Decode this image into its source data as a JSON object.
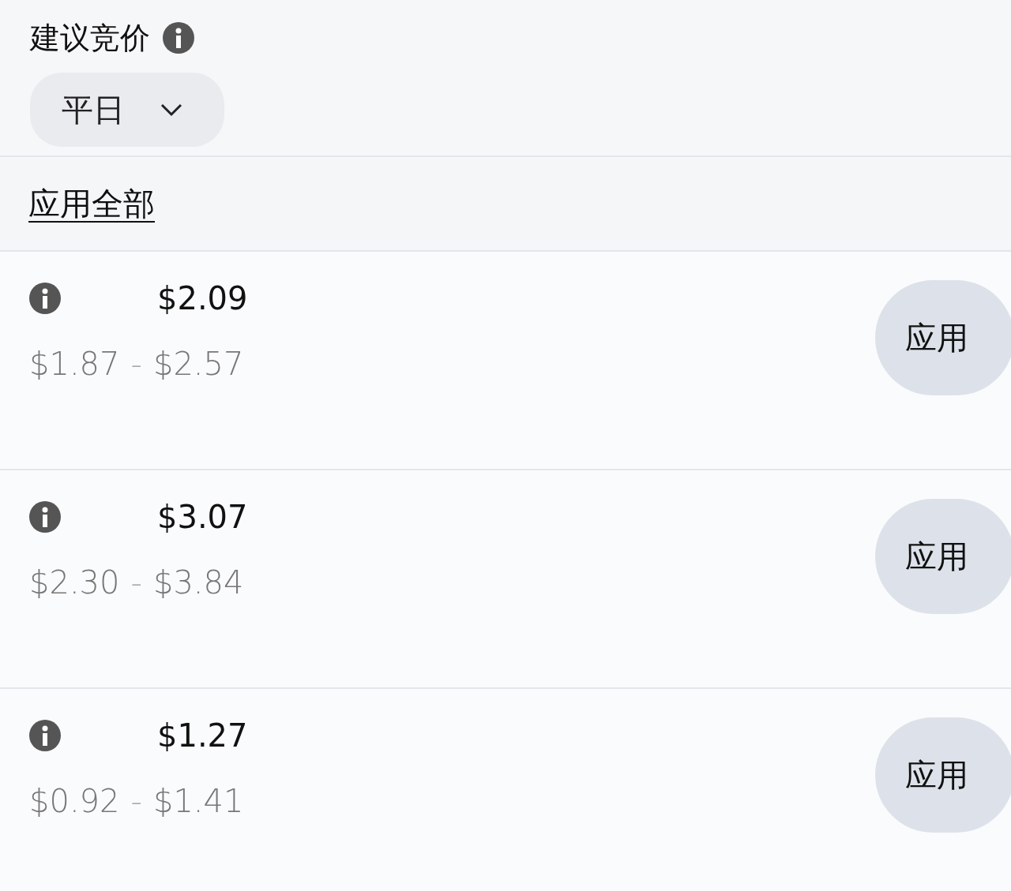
{
  "title": "建议竞价",
  "day_filter": {
    "value": "平日"
  },
  "apply_all": "应用全部",
  "bids": [
    {
      "price": "$2.09",
      "range_low": "$1.87",
      "separator": "-",
      "range_high": "$2.57",
      "button": "应用"
    },
    {
      "price": "$3.07",
      "range_low": "$2.30",
      "separator": "-",
      "range_high": "$3.84",
      "button": "应用"
    },
    {
      "price": "$1.27",
      "range_low": "$0.92",
      "separator": "-",
      "range_high": "$1.41",
      "button": "应用"
    }
  ]
}
